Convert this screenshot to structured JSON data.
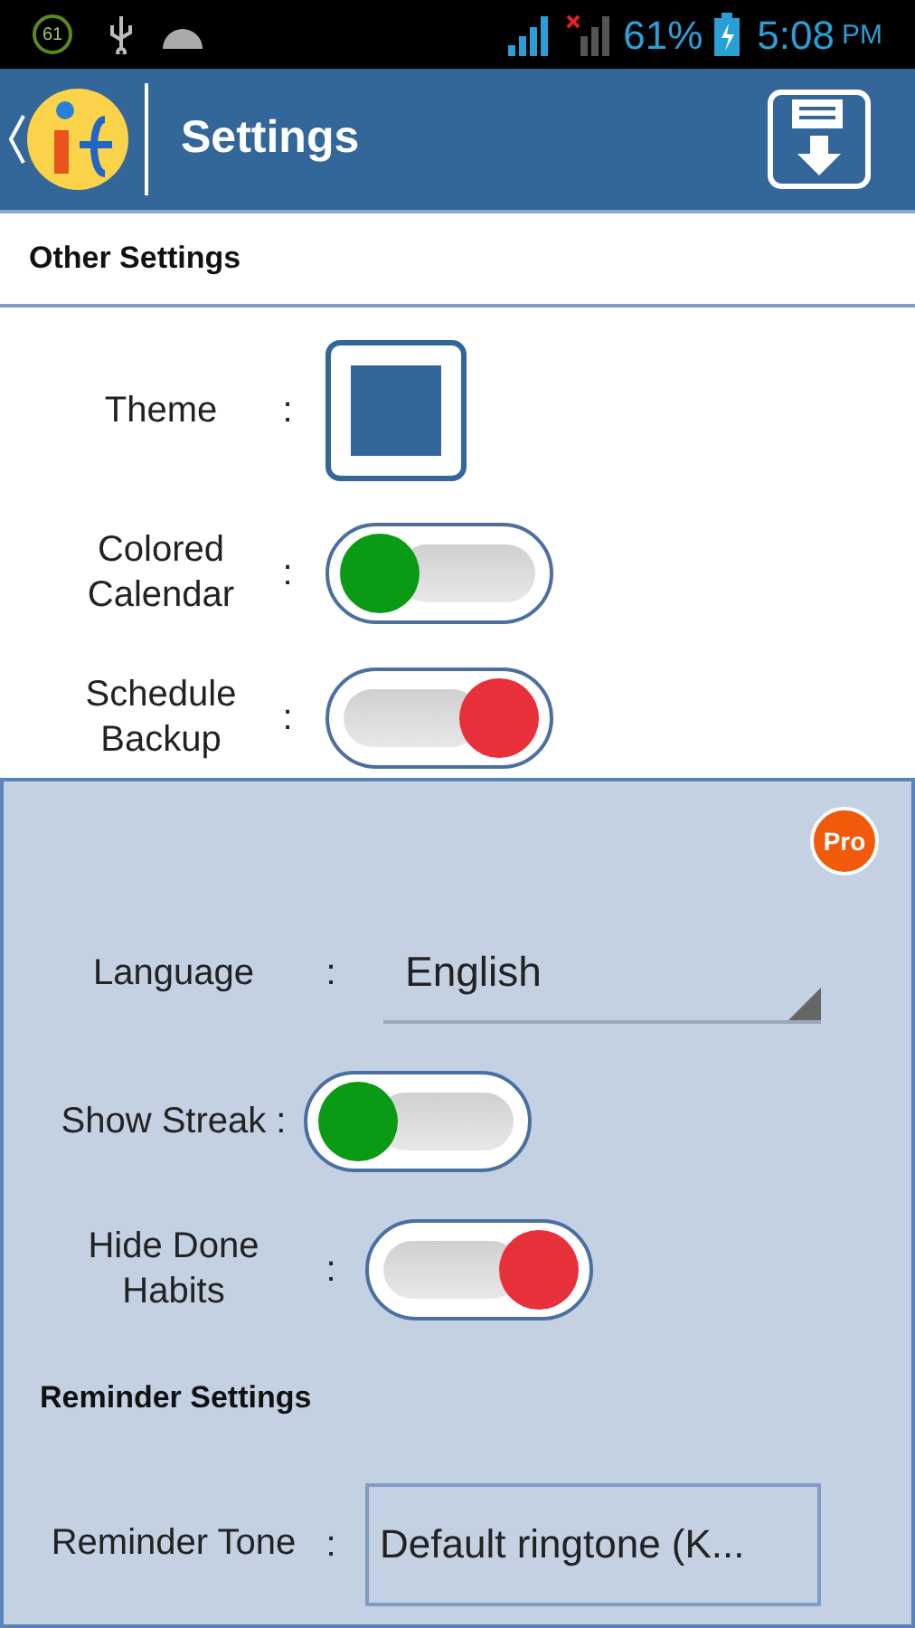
{
  "status_bar": {
    "notification_badge": "61",
    "battery_percent": "61%",
    "time": "5:08",
    "time_suffix": "PM"
  },
  "header": {
    "title": "Settings"
  },
  "other_settings": {
    "title": "Other Settings",
    "rows": [
      {
        "kind": "theme",
        "label": "Theme",
        "colon": ":",
        "color": "#336699"
      },
      {
        "kind": "toggle",
        "label": "Colored Calendar",
        "colon": ":",
        "on": true
      },
      {
        "kind": "toggle",
        "label": "Schedule Backup",
        "colon": ":",
        "on": false
      }
    ]
  },
  "pro_panel": {
    "badge": "Pro",
    "rows": [
      {
        "kind": "dropdown",
        "label": "Language",
        "colon": ":",
        "value": "English"
      },
      {
        "kind": "toggle",
        "label": "Show Streak :",
        "on": true
      },
      {
        "kind": "toggle",
        "label": "Hide Done Habits",
        "colon": ":",
        "on": false
      }
    ],
    "reminder_title": "Reminder Settings",
    "reminder_tone": {
      "label": "Reminder Tone",
      "colon": ":",
      "value": "Default ringtone (K..."
    }
  }
}
